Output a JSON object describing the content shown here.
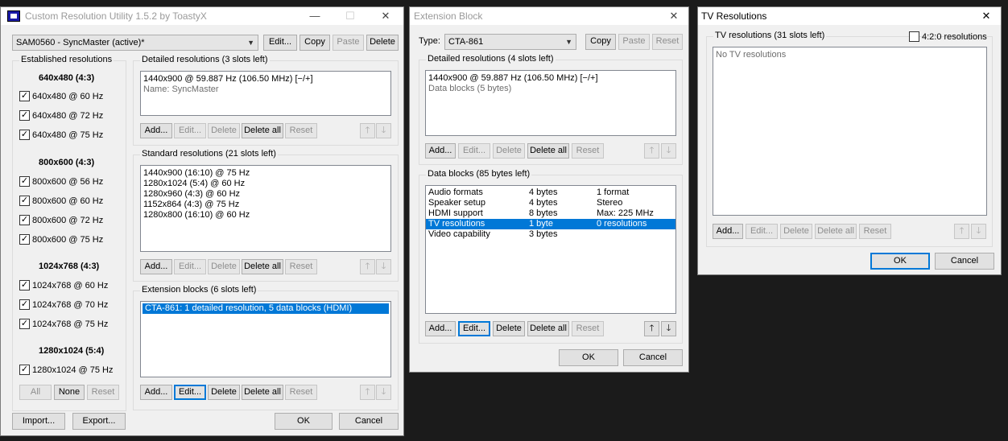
{
  "main": {
    "title": "Custom Resolution Utility 1.5.2 by ToastyX",
    "monitor_select": "SAM0560 - SyncMaster (active)*",
    "top_buttons": {
      "edit": "Edit...",
      "copy": "Copy",
      "paste": "Paste",
      "delete": "Delete"
    },
    "established": {
      "label": "Established resolutions",
      "groups": [
        {
          "header": "640x480 (4:3)",
          "items": [
            "640x480 @ 60 Hz",
            "640x480 @ 72 Hz",
            "640x480 @ 75 Hz"
          ]
        },
        {
          "header": "800x600 (4:3)",
          "items": [
            "800x600 @ 56 Hz",
            "800x600 @ 60 Hz",
            "800x600 @ 72 Hz",
            "800x600 @ 75 Hz"
          ]
        },
        {
          "header": "1024x768 (4:3)",
          "items": [
            "1024x768 @ 60 Hz",
            "1024x768 @ 70 Hz",
            "1024x768 @ 75 Hz"
          ]
        },
        {
          "header": "1280x1024 (5:4)",
          "items": [
            "1280x1024 @ 75 Hz"
          ]
        }
      ],
      "buttons": {
        "all": "All",
        "none": "None",
        "reset": "Reset"
      }
    },
    "detailed": {
      "label": "Detailed resolutions (3 slots left)",
      "items": [
        "1440x900 @ 59.887 Hz (106.50 MHz) [−/+]",
        "Name: SyncMaster"
      ]
    },
    "standard": {
      "label": "Standard resolutions (21 slots left)",
      "items": [
        "1440x900 (16:10) @ 75 Hz",
        "1280x1024 (5:4) @ 60 Hz",
        "1280x960 (4:3) @ 60 Hz",
        "1152x864 (4:3) @ 75 Hz",
        "1280x800 (16:10) @ 60 Hz"
      ]
    },
    "extension": {
      "label": "Extension blocks (6 slots left)",
      "items": [
        "CTA-861: 1 detailed resolution, 5 data blocks (HDMI)"
      ]
    },
    "row_buttons": {
      "add": "Add...",
      "edit": "Edit...",
      "delete": "Delete",
      "delete_all": "Delete all",
      "reset": "Reset"
    },
    "bottom": {
      "import": "Import...",
      "export": "Export...",
      "ok": "OK",
      "cancel": "Cancel"
    }
  },
  "ext": {
    "title": "Extension Block",
    "type_label": "Type:",
    "type_value": "CTA-861",
    "buttons": {
      "copy": "Copy",
      "paste": "Paste",
      "reset": "Reset"
    },
    "detailed": {
      "label": "Detailed resolutions (4 slots left)",
      "items": [
        "1440x900 @ 59.887 Hz (106.50 MHz) [−/+]",
        "Data blocks (5 bytes)"
      ]
    },
    "data_blocks": {
      "label": "Data blocks (85 bytes left)",
      "rows": [
        {
          "name": "Audio formats",
          "size": "4 bytes",
          "info": "1 format"
        },
        {
          "name": "Speaker setup",
          "size": "4 bytes",
          "info": "Stereo"
        },
        {
          "name": "HDMI support",
          "size": "8 bytes",
          "info": "Max: 225 MHz"
        },
        {
          "name": "TV resolutions",
          "size": "1 byte",
          "info": "0 resolutions"
        },
        {
          "name": "Video capability",
          "size": "3 bytes",
          "info": ""
        }
      ]
    },
    "row_buttons": {
      "add": "Add...",
      "edit": "Edit...",
      "delete": "Delete",
      "delete_all": "Delete all",
      "reset": "Reset"
    },
    "bottom": {
      "ok": "OK",
      "cancel": "Cancel"
    }
  },
  "tv": {
    "title": "TV Resolutions",
    "group_label": "TV resolutions (31 slots left)",
    "checkbox_label": "4:2:0 resolutions",
    "empty_text": "No TV resolutions",
    "row_buttons": {
      "add": "Add...",
      "edit": "Edit...",
      "delete": "Delete",
      "delete_all": "Delete all",
      "reset": "Reset"
    },
    "bottom": {
      "ok": "OK",
      "cancel": "Cancel"
    }
  },
  "icons": {
    "close": "✕",
    "minimize": "—",
    "maximize": "☐",
    "up": "🡑",
    "down": "🡓",
    "check": "✓",
    "dropdown": "▼"
  }
}
